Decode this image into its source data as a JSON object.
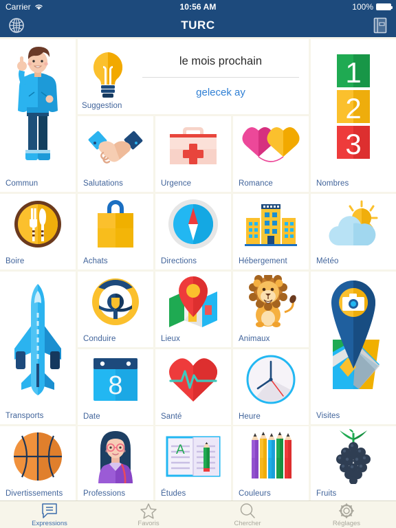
{
  "status_bar": {
    "carrier": "Carrier",
    "wifi_icon": "wifi-icon",
    "time": "10:56 AM",
    "battery_percent": "100%",
    "battery_icon": "battery-full-icon"
  },
  "nav_bar": {
    "left_icon": "globe-icon",
    "title": "TURC",
    "right_icon": "flashcards-book-icon"
  },
  "suggestion": {
    "label": "Suggestion",
    "icon": "lightbulb-icon",
    "phrase": "le mois prochain",
    "translation": "gelecek ay",
    "phrase_color": "#2b2b2b",
    "translation_color": "#2f7fd4"
  },
  "categories": [
    {
      "label": "Commun",
      "icon": "man-pointing-up-icon"
    },
    {
      "label": "Salutations",
      "icon": "handshake-icon"
    },
    {
      "label": "Urgence",
      "icon": "first-aid-kit-icon"
    },
    {
      "label": "Romance",
      "icon": "two-hearts-icon"
    },
    {
      "label": "Nombres",
      "icon": "numbers-123-icon"
    },
    {
      "label": "Boire",
      "icon": "fork-knife-plate-icon"
    },
    {
      "label": "Achats",
      "icon": "shopping-bag-icon"
    },
    {
      "label": "Directions",
      "icon": "compass-icon"
    },
    {
      "label": "Hébergement",
      "icon": "hotel-buildings-icon"
    },
    {
      "label": "Météo",
      "icon": "sun-cloud-icon"
    },
    {
      "label": "Transports",
      "icon": "airplane-icon"
    },
    {
      "label": "Conduire",
      "icon": "steering-wheel-icon"
    },
    {
      "label": "Lieux",
      "icon": "map-pin-icon"
    },
    {
      "label": "Animaux",
      "icon": "lion-icon"
    },
    {
      "label": "Visites",
      "icon": "camera-pin-map-icon"
    },
    {
      "label": "Date",
      "icon": "calendar-icon"
    },
    {
      "label": "Santé",
      "icon": "heart-pulse-icon"
    },
    {
      "label": "Heure",
      "icon": "clock-icon"
    },
    {
      "label": "Divertissements",
      "icon": "basketball-icon"
    },
    {
      "label": "Professions",
      "icon": "businesswoman-icon"
    },
    {
      "label": "Études",
      "icon": "open-notebook-pencil-icon"
    },
    {
      "label": "Couleurs",
      "icon": "colored-pencils-icon"
    },
    {
      "label": "Fruits",
      "icon": "grapes-icon"
    }
  ],
  "calendar_day": "8",
  "numbers": [
    "1",
    "2",
    "3"
  ],
  "study_letter": "A",
  "tab_bar": {
    "tabs": [
      {
        "label": "Expressions",
        "icon": "speech-bubble-icon",
        "active": true
      },
      {
        "label": "Favoris",
        "icon": "star-icon",
        "active": false
      },
      {
        "label": "Chercher",
        "icon": "magnifier-icon",
        "active": false
      },
      {
        "label": "Réglages",
        "icon": "gear-icon",
        "active": false
      }
    ]
  },
  "colors": {
    "nav_background": "#1d4a7c",
    "page_background": "#f7f5ea",
    "cell_background": "#ffffff",
    "label_text": "#40639a",
    "tab_active": "#3b6cab",
    "tab_inactive": "#a9a79c"
  }
}
